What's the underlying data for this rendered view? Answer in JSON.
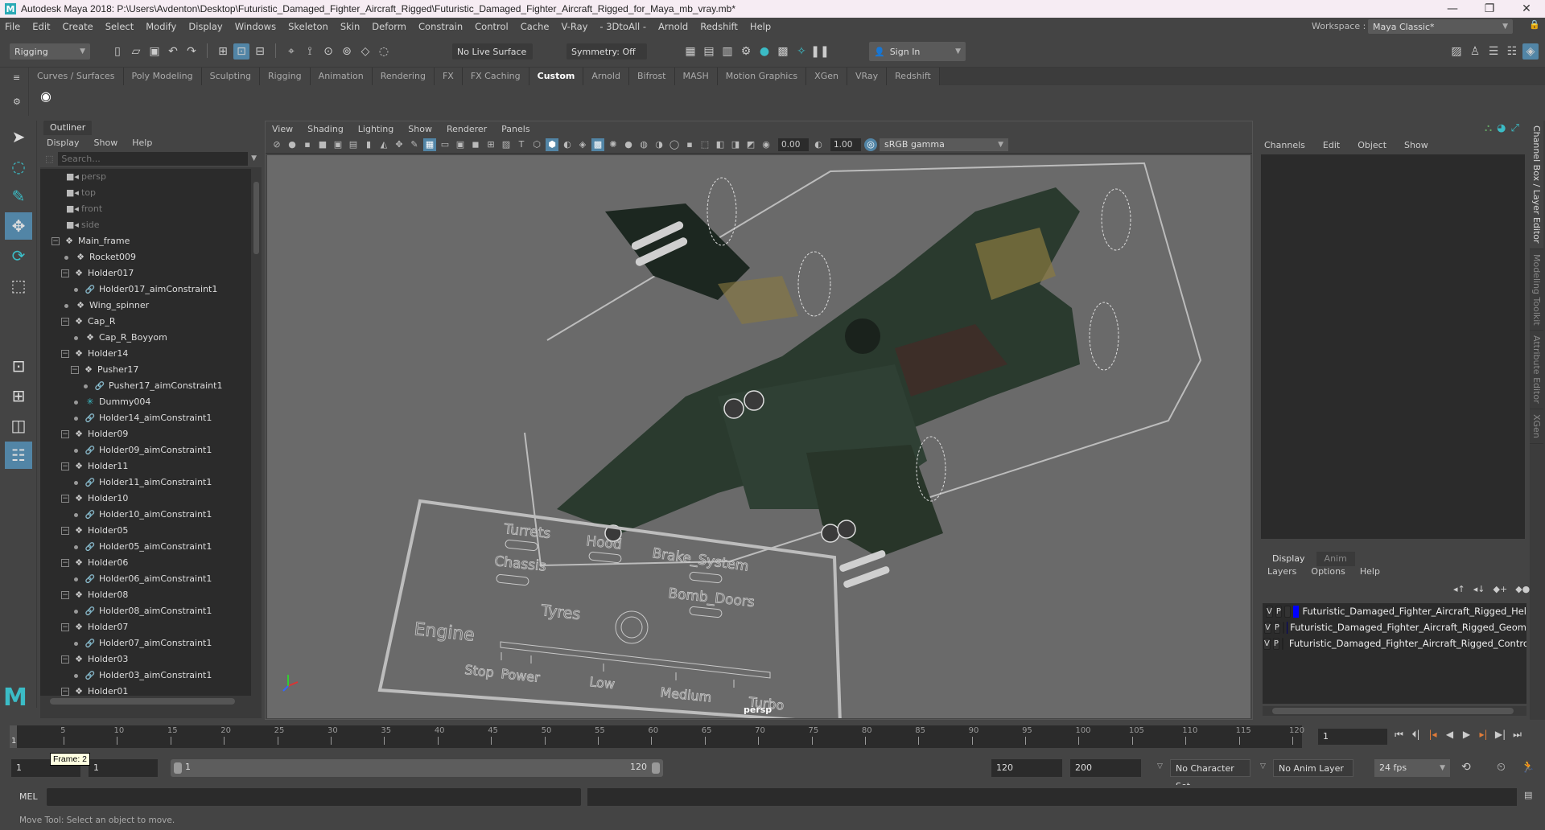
{
  "window": {
    "title": "Autodesk Maya 2018: P:\\Users\\Avdenton\\Desktop\\Futuristic_Damaged_Fighter_Aircraft_Rigged\\Futuristic_Damaged_Fighter_Aircraft_Rigged_for_Maya_mb_vray.mb*",
    "controls": {
      "minimize": "—",
      "restore": "❐",
      "close": "✕"
    }
  },
  "menubar": [
    "File",
    "Edit",
    "Create",
    "Select",
    "Modify",
    "Display",
    "Windows",
    "Skeleton",
    "Skin",
    "Deform",
    "Constrain",
    "Control",
    "Cache",
    "V-Ray",
    "- 3DtoAll -",
    "Arnold",
    "Redshift",
    "Help"
  ],
  "toolbar": {
    "mode": "Rigging",
    "live_surface": "No Live Surface",
    "symmetry": "Symmetry: Off",
    "sign_in": "Sign In",
    "workspace_label": "Workspace :",
    "workspace_value": "Maya Classic*"
  },
  "shelf": {
    "tabs": [
      "Curves / Surfaces",
      "Poly Modeling",
      "Sculpting",
      "Rigging",
      "Animation",
      "Rendering",
      "FX",
      "FX Caching",
      "Custom",
      "Arnold",
      "Bifrost",
      "MASH",
      "Motion Graphics",
      "XGen",
      "VRay",
      "Redshift"
    ],
    "active_tab": "Custom"
  },
  "outliner": {
    "title": "Outliner",
    "menu": [
      "Display",
      "Show",
      "Help"
    ],
    "search_placeholder": "Search...",
    "items": [
      {
        "label": "persp",
        "type": "camera",
        "depth": 0
      },
      {
        "label": "top",
        "type": "camera",
        "depth": 0
      },
      {
        "label": "front",
        "type": "camera",
        "depth": 0
      },
      {
        "label": "side",
        "type": "camera",
        "depth": 0
      },
      {
        "label": "Main_frame",
        "type": "transform",
        "depth": 0,
        "expanded": true
      },
      {
        "label": "Rocket009",
        "type": "transform",
        "depth": 1
      },
      {
        "label": "Holder017",
        "type": "transform",
        "depth": 1,
        "expanded": true
      },
      {
        "label": "Holder017_aimConstraint1",
        "type": "constraint",
        "depth": 2
      },
      {
        "label": "Wing_spinner",
        "type": "transform",
        "depth": 1
      },
      {
        "label": "Cap_R",
        "type": "transform",
        "depth": 1,
        "expanded": true
      },
      {
        "label": "Cap_R_Boyyom",
        "type": "transform",
        "depth": 2
      },
      {
        "label": "Holder14",
        "type": "transform",
        "depth": 1,
        "expanded": true
      },
      {
        "label": "Pusher17",
        "type": "transform",
        "depth": 2,
        "expanded": true
      },
      {
        "label": "Pusher17_aimConstraint1",
        "type": "constraint",
        "depth": 3
      },
      {
        "label": "Dummy004",
        "type": "dummy",
        "depth": 2
      },
      {
        "label": "Holder14_aimConstraint1",
        "type": "constraint",
        "depth": 2
      },
      {
        "label": "Holder09",
        "type": "transform",
        "depth": 1,
        "expanded": true
      },
      {
        "label": "Holder09_aimConstraint1",
        "type": "constraint",
        "depth": 2
      },
      {
        "label": "Holder11",
        "type": "transform",
        "depth": 1,
        "expanded": true
      },
      {
        "label": "Holder11_aimConstraint1",
        "type": "constraint",
        "depth": 2
      },
      {
        "label": "Holder10",
        "type": "transform",
        "depth": 1,
        "expanded": true
      },
      {
        "label": "Holder10_aimConstraint1",
        "type": "constraint",
        "depth": 2
      },
      {
        "label": "Holder05",
        "type": "transform",
        "depth": 1,
        "expanded": true
      },
      {
        "label": "Holder05_aimConstraint1",
        "type": "constraint",
        "depth": 2
      },
      {
        "label": "Holder06",
        "type": "transform",
        "depth": 1,
        "expanded": true
      },
      {
        "label": "Holder06_aimConstraint1",
        "type": "constraint",
        "depth": 2
      },
      {
        "label": "Holder08",
        "type": "transform",
        "depth": 1,
        "expanded": true
      },
      {
        "label": "Holder08_aimConstraint1",
        "type": "constraint",
        "depth": 2
      },
      {
        "label": "Holder07",
        "type": "transform",
        "depth": 1,
        "expanded": true
      },
      {
        "label": "Holder07_aimConstraint1",
        "type": "constraint",
        "depth": 2
      },
      {
        "label": "Holder03",
        "type": "transform",
        "depth": 1,
        "expanded": true
      },
      {
        "label": "Holder03_aimConstraint1",
        "type": "constraint",
        "depth": 2
      },
      {
        "label": "Holder01",
        "type": "transform",
        "depth": 1,
        "expanded": true
      }
    ]
  },
  "viewport": {
    "menu": [
      "View",
      "Shading",
      "Lighting",
      "Show",
      "Renderer",
      "Panels"
    ],
    "exposure": "0.00",
    "gamma": "1.00",
    "color_management": "sRGB gamma",
    "camera": "persp",
    "control_panel": {
      "labels": [
        "Turrets",
        "Hood",
        "Brake_System",
        "Chassis",
        "Bomb_Doors",
        "Tyres",
        "Engine"
      ],
      "engine_levels": [
        "Stop",
        "Power",
        "Low",
        "Medium",
        "Turbo"
      ]
    }
  },
  "channel_box": {
    "menu": [
      "Channels",
      "Edit",
      "Object",
      "Show"
    ]
  },
  "layer_editor": {
    "tabs": [
      "Display",
      "Anim"
    ],
    "active_tab": "Display",
    "menu": [
      "Layers",
      "Options",
      "Help"
    ],
    "layers": [
      {
        "v": "V",
        "p": "P",
        "name": "Futuristic_Damaged_Fighter_Aircraft_Rigged_Hel",
        "color": "#0000ff"
      },
      {
        "v": "V",
        "p": "P",
        "name": "Futuristic_Damaged_Fighter_Aircraft_Rigged_Geom",
        "color": "#000066"
      },
      {
        "v": "V",
        "p": "P",
        "name": "Futuristic_Damaged_Fighter_Aircraft_Rigged_Contro",
        "color": "#990033"
      }
    ]
  },
  "side_tabs": [
    "Channel Box / Layer Editor",
    "Modeling Toolkit",
    "Attribute Editor",
    "XGen"
  ],
  "timeline": {
    "ticks": [
      5,
      10,
      15,
      20,
      25,
      30,
      35,
      40,
      45,
      50,
      55,
      60,
      65,
      70,
      75,
      80,
      85,
      90,
      95,
      100,
      105,
      110,
      115,
      120
    ],
    "current_frame_marker": "1",
    "current_frame": "1",
    "min": 1,
    "max": 120
  },
  "range": {
    "start": "1",
    "playback_start": "1",
    "range_start_label": "1",
    "range_end_label": "120",
    "playback_end": "120",
    "end": "200",
    "character_set": "No Character Set",
    "anim_layer": "No Anim Layer",
    "fps": "24 fps"
  },
  "tooltip": "Frame: 2",
  "command_line": {
    "label": "MEL"
  },
  "status": "Move Tool: Select an object to move."
}
